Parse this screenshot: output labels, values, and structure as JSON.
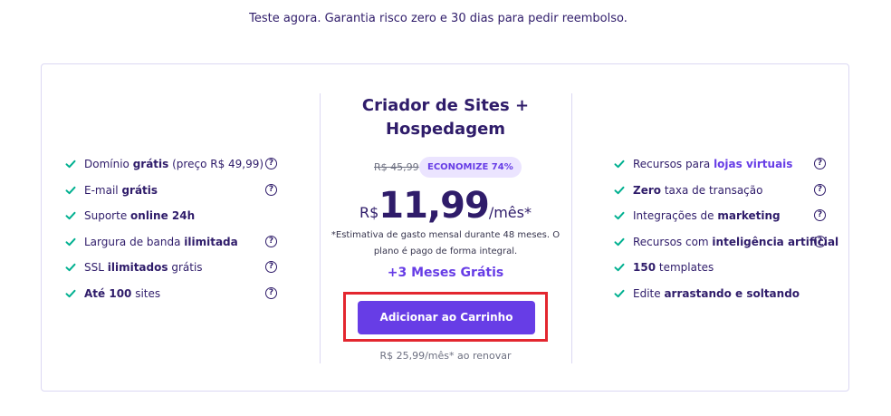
{
  "tagline": "Teste agora. Garantia risco zero e 30 dias para pedir reembolso.",
  "colors": {
    "accent": "#673de6",
    "check": "#00b090",
    "text": "#2f1c6a",
    "highlight_border": "#e3262f",
    "badge_bg": "#ebe4ff"
  },
  "icons": {
    "check": "check-icon",
    "help": "help-circle-icon"
  },
  "left_features": [
    {
      "parts": [
        {
          "t": "Domínio "
        },
        {
          "t": "grátis",
          "b": true
        },
        {
          "t": " (preço R$ 49,99)"
        }
      ],
      "help": true
    },
    {
      "parts": [
        {
          "t": "E-mail "
        },
        {
          "t": "grátis",
          "b": true
        }
      ],
      "help": true
    },
    {
      "parts": [
        {
          "t": "Suporte "
        },
        {
          "t": "online 24h",
          "b": true
        }
      ],
      "help": false
    },
    {
      "parts": [
        {
          "t": "Largura de banda "
        },
        {
          "t": "ilimitada",
          "b": true
        }
      ],
      "help": true
    },
    {
      "parts": [
        {
          "t": "SSL "
        },
        {
          "t": "ilimitados",
          "b": true
        },
        {
          "t": " grátis"
        }
      ],
      "help": true
    },
    {
      "parts": [
        {
          "t": "Até 100",
          "b": true
        },
        {
          "t": " sites"
        }
      ],
      "help": true
    }
  ],
  "plan": {
    "title_line1": "Criador de Sites +",
    "title_line2": "Hospedagem",
    "old_price": "R$ 45,99",
    "discount_badge": "ECONOMIZE 74%",
    "currency": "R$",
    "price": "11,99",
    "period": "/mês*",
    "estimate_line1": "*Estimativa de gasto mensal durante 48 meses. O",
    "estimate_line2": "plano é pago de forma integral.",
    "bonus": "+3 Meses Grátis",
    "cta_label": "Adicionar ao Carrinho",
    "renewal": "R$ 25,99/mês* ao renovar"
  },
  "right_features": [
    {
      "parts": [
        {
          "t": "Recursos para "
        },
        {
          "t": "lojas virtuais",
          "l": true
        }
      ],
      "help": true
    },
    {
      "parts": [
        {
          "t": "Zero",
          "b": true
        },
        {
          "t": " taxa de transação"
        }
      ],
      "help": true
    },
    {
      "parts": [
        {
          "t": "Integrações de "
        },
        {
          "t": "marketing",
          "b": true
        }
      ],
      "help": true
    },
    {
      "parts": [
        {
          "t": "Recursos com "
        },
        {
          "t": "inteligência artificial",
          "b": true
        }
      ],
      "help": true
    },
    {
      "parts": [
        {
          "t": "150",
          "b": true
        },
        {
          "t": " templates"
        }
      ],
      "help": false
    },
    {
      "parts": [
        {
          "t": "Edite "
        },
        {
          "t": "arrastando e soltando",
          "b": true
        }
      ],
      "help": false
    }
  ]
}
